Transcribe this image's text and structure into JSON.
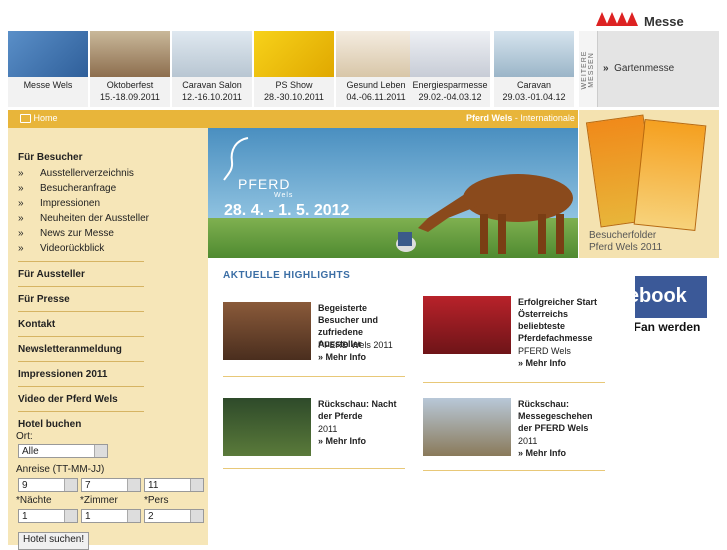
{
  "brand": {
    "logo_text": "Messe Wels",
    "colors": {
      "accent": "#e8b53a",
      "brand_red": "#d22",
      "facebook": "#3b5998",
      "sidebar_bg": "#f6e6b8",
      "link_blue": "#3b6ea5"
    }
  },
  "events": [
    {
      "name": "Messe Wels",
      "date": ""
    },
    {
      "name": "Oktoberfest",
      "date": "15.-18.09.2011"
    },
    {
      "name": "Caravan Salon",
      "date": "12.-16.10.2011"
    },
    {
      "name": "PS Show",
      "date": "28.-30.10.2011"
    },
    {
      "name": "Gesund Leben",
      "date": "04.-06.11.2011"
    },
    {
      "name": "Energiesparmesse",
      "date": "29.02.-04.03.12"
    },
    {
      "name": "Caravan",
      "date": "29.03.-01.04.12"
    }
  ],
  "weitere": {
    "label": "WEITERE MESSEN",
    "link": "Gartenmesse",
    "link_icon": "double-chevron-right-icon"
  },
  "bar": {
    "home": "Home",
    "home_icon": "home-icon",
    "ticker_bold": "Pferd Wels",
    "ticker_rest": " - Internationale Pferdefachmesse"
  },
  "sidebar": {
    "besucher_title": "Für Besucher",
    "besucher_items": [
      "Ausstellerverzeichnis",
      "Besucheranfrage",
      "Impressionen",
      "Neuheiten der Aussteller",
      "News zur Messe",
      "Videorückblick"
    ],
    "bullet": "»",
    "aussteller": "Für Aussteller",
    "presse": "Für Presse",
    "kontakt": "Kontakt",
    "newsletter": "Newsletteranmeldung",
    "impressionen": "Impressionen 2011",
    "video": "Video der Pferd Wels",
    "hotel": {
      "title": "Hotel buchen",
      "ort_label": "Ort:",
      "ort_value": "Alle",
      "anreise_label": "Anreise (TT-MM-JJ)",
      "day": "9",
      "month": "7",
      "year": "11",
      "naechte_label": "*Nächte",
      "zimmer_label": "*Zimmer",
      "pers_label": "*Pers",
      "naechte": "1",
      "zimmer": "1",
      "pers": "2",
      "button": "Hotel suchen!"
    }
  },
  "hero": {
    "pferd": "PFERD",
    "wels": "Wels",
    "date": "28. 4. - 1. 5. 2012"
  },
  "folder": {
    "line1": "Besucherfolder",
    "line2": "Pferd Wels 2011"
  },
  "facebook": {
    "logo": "facebook",
    "cta": "Jetzt Fan werden"
  },
  "highlights": {
    "heading": "AKTUELLE HIGHLIGHTS",
    "more_icon": "double-chevron-right-icon",
    "items": [
      {
        "title": "Begeisterte Besucher und zufriedene Aussteller",
        "sub": "PFERD Wels 2011",
        "more": "Mehr Info"
      },
      {
        "title": "Erfolgreicher Start Österreichs beliebteste Pferdefachmesse",
        "sub": "PFERD Wels",
        "more": "Mehr Info"
      },
      {
        "title": "Rückschau: Nacht der Pferde",
        "sub": "2011",
        "more": "Mehr Info"
      },
      {
        "title": "Rückschau: Messegeschehen der PFERD Wels",
        "sub": "2011",
        "more": "Mehr Info"
      }
    ]
  }
}
